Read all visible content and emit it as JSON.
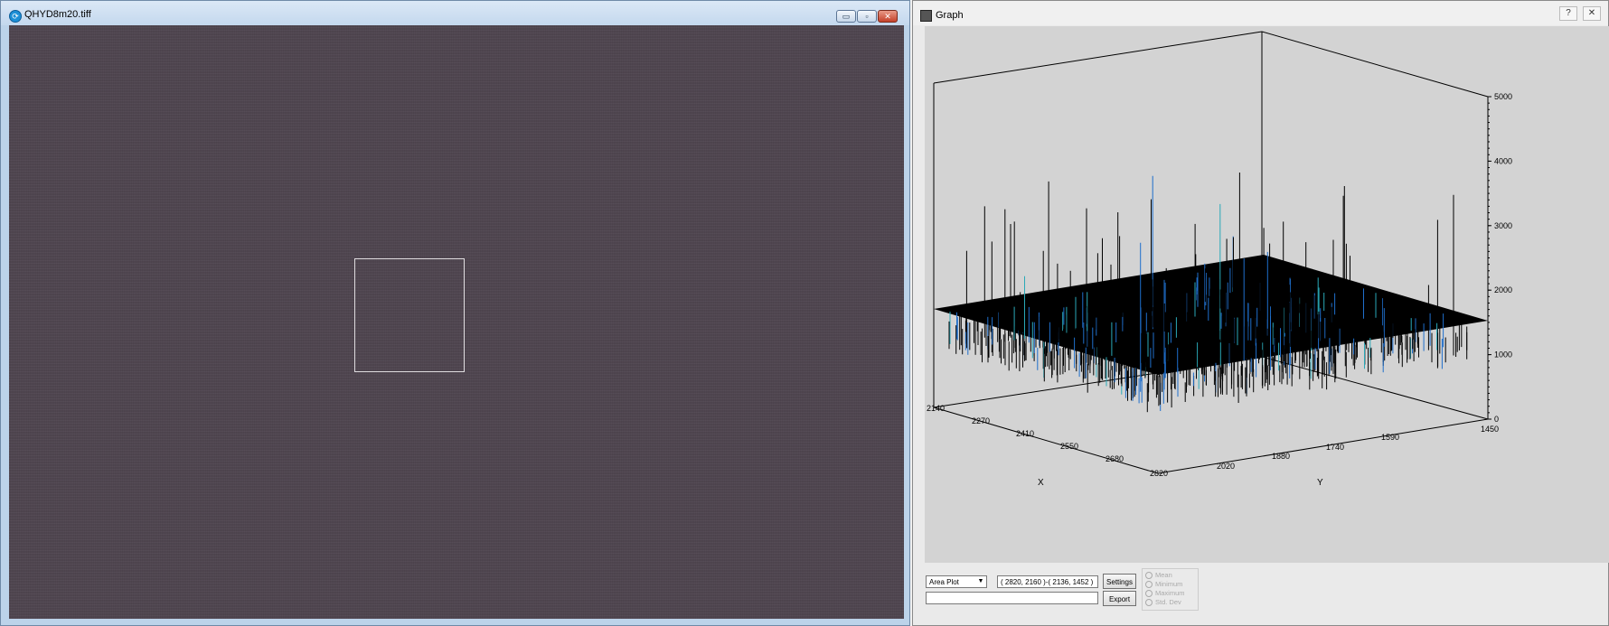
{
  "left_window": {
    "title": "QHYD8m20.tiff",
    "controls": {
      "minimize": "▭",
      "maximize": "▫",
      "close": "✕"
    }
  },
  "right_window": {
    "title": "Graph",
    "help": "?",
    "close": "✕"
  },
  "controls": {
    "plot_type_selected": "Area Plot",
    "coordinates": "( 2820, 2160 )-( 2136, 1452 )",
    "settings_label": "Settings",
    "export_label": "Export",
    "radio_options": [
      "Mean",
      "Minimum",
      "Maximum",
      "Std. Dev"
    ]
  },
  "chart_data": {
    "type": "area",
    "title": "",
    "x_axis": {
      "label": "X",
      "ticks": [
        "2140",
        "2270",
        "2410",
        "2550",
        "2680",
        "2820"
      ]
    },
    "y_axis": {
      "label": "Y",
      "ticks": [
        "2020",
        "1880",
        "1740",
        "1590",
        "1450"
      ]
    },
    "z_axis": {
      "ticks": [
        "0",
        "1000",
        "2000",
        "3000",
        "4000",
        "5000"
      ],
      "range": [
        0,
        5000
      ]
    },
    "description_values": {
      "baseline_level": 1200,
      "max_spike": 4200
    },
    "colors": {
      "surface": "#000000",
      "highlight": "#1f6fcc",
      "background": "#d3d3d3"
    }
  }
}
